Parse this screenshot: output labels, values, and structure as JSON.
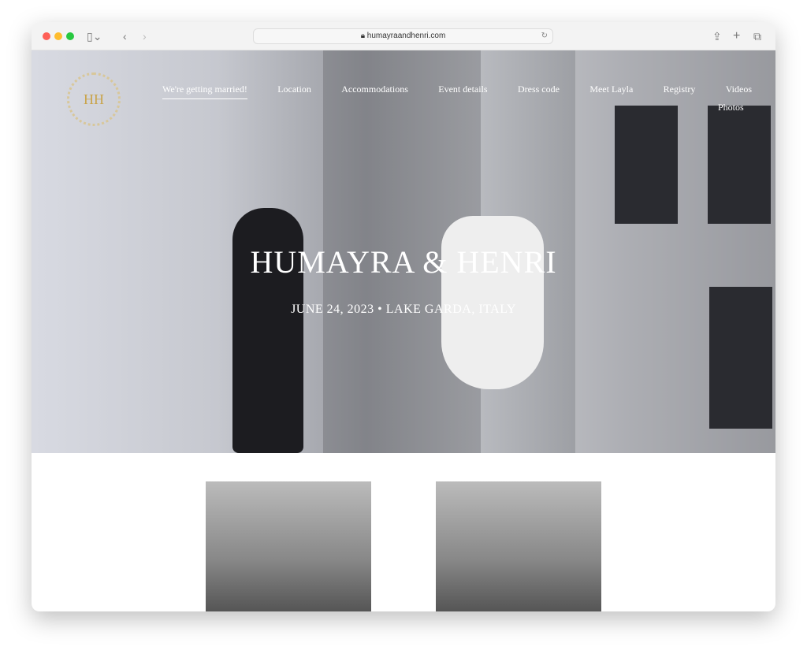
{
  "browser": {
    "url": "humayraandhenri.com"
  },
  "site": {
    "logo_text": "HH",
    "nav": [
      "We're getting married!",
      "Location",
      "Accommodations",
      "Event details",
      "Dress code",
      "Meet Layla",
      "Registry",
      "Videos"
    ],
    "nav_second_row": "Photos",
    "title": "HUMAYRA & HENRI",
    "subtitle": "JUNE 24, 2023 • LAKE GARDA, ITALY"
  }
}
